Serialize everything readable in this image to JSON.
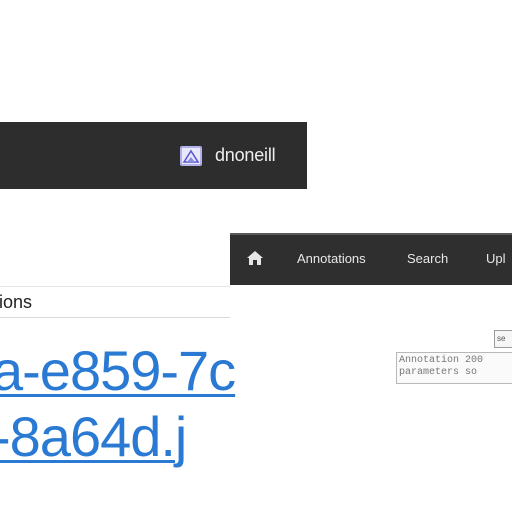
{
  "user_bar": {
    "username": "dnoneill",
    "avatar_icon": "user-avatar-icon",
    "background": "#2d2d2d"
  },
  "nav": {
    "home_icon": "home-icon",
    "items": [
      {
        "label": "Annotations"
      },
      {
        "label": "Search"
      },
      {
        "label": "Upl"
      }
    ],
    "background": "#2f2f2f"
  },
  "main": {
    "section_heading": "tions",
    "annotation_id": "a-e859-7c-8a64d.j"
  },
  "panel": {
    "mini_box_text": "se",
    "info_lines": [
      "Annotation 200",
      "parameters so"
    ]
  },
  "colors": {
    "link": "#2a79d3"
  }
}
